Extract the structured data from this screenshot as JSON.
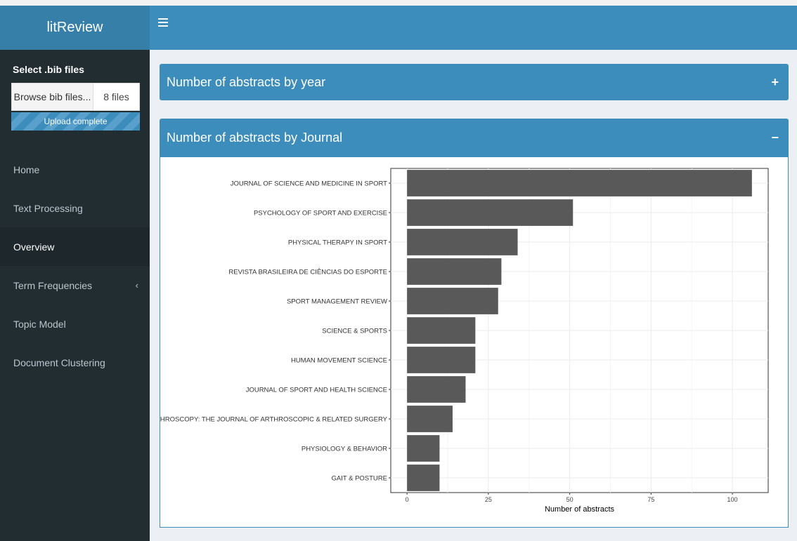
{
  "app": {
    "title": "litReview"
  },
  "sidebar": {
    "file_label": "Select .bib files",
    "browse_label": "Browse bib files...",
    "file_count": "8 files",
    "progress_text": "Upload complete",
    "progress": 1.0,
    "items": [
      {
        "label": "Home"
      },
      {
        "label": "Text Processing"
      },
      {
        "label": "Overview",
        "active": true
      },
      {
        "label": "Term Frequencies",
        "chevron": "‹"
      },
      {
        "label": "Topic Model"
      },
      {
        "label": "Document Clustering"
      }
    ]
  },
  "boxes": [
    {
      "title": "Number of abstracts by year",
      "tool": "+"
    },
    {
      "title": "Number of abstracts by Journal",
      "tool": "−"
    }
  ],
  "colors": {
    "header": "#3c8dbc",
    "logo": "#367fa9",
    "sidebar": "#222d32",
    "bar": "#595959"
  },
  "chart_data": {
    "type": "bar",
    "orientation": "horizontal",
    "categories": [
      "JOURNAL OF SCIENCE AND MEDICINE IN SPORT",
      "PSYCHOLOGY OF SPORT AND EXERCISE",
      "PHYSICAL THERAPY IN SPORT",
      "REVISTA BRASILEIRA DE CIÊNCIAS DO ESPORTE",
      "SPORT MANAGEMENT REVIEW",
      "SCIENCE & SPORTS",
      "HUMAN MOVEMENT SCIENCE",
      "JOURNAL OF SPORT AND HEALTH SCIENCE",
      "ARTHROSCOPY: THE JOURNAL OF ARTHROSCOPIC & RELATED SURGERY",
      "PHYSIOLOGY & BEHAVIOR",
      "GAIT & POSTURE"
    ],
    "values": [
      106,
      51,
      34,
      29,
      28,
      21,
      21,
      18,
      14,
      10,
      10
    ],
    "xlabel": "Number of abstracts",
    "xticks": [
      0,
      25,
      50,
      75,
      100
    ],
    "xlim": [
      -5,
      111
    ],
    "grid": true
  }
}
